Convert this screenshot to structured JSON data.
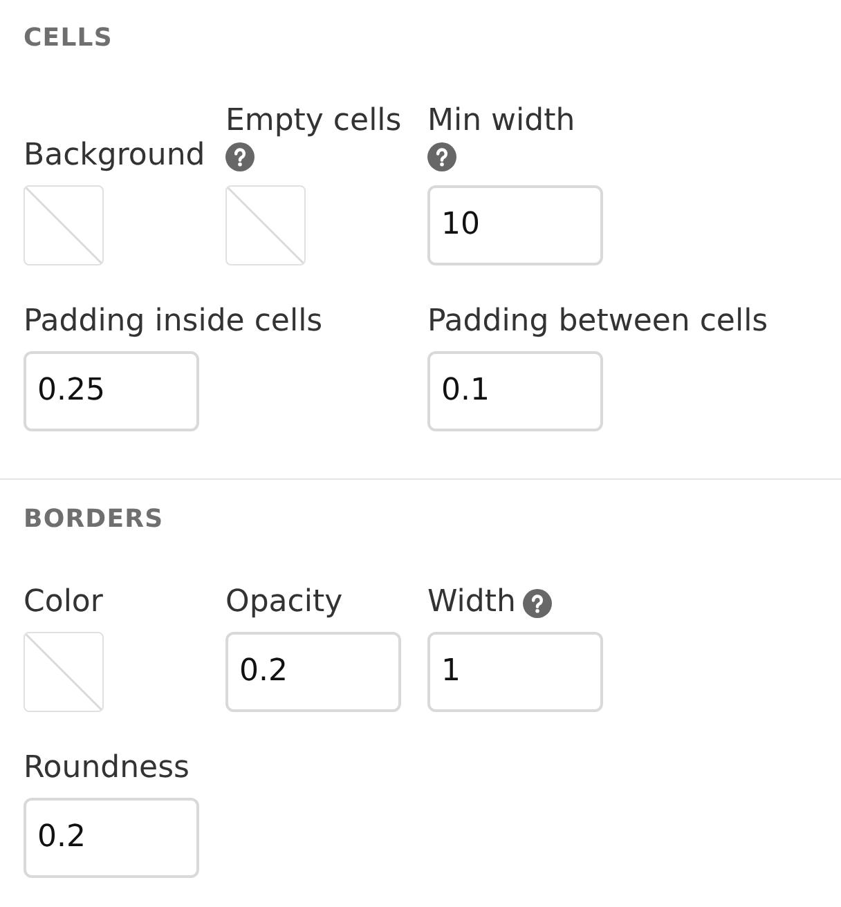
{
  "sections": [
    {
      "title": "CELLS",
      "rows": [
        [
          {
            "kind": "swatch",
            "label": "Background"
          },
          {
            "kind": "swatch",
            "label": "Empty cells",
            "help": true
          },
          {
            "kind": "number",
            "label": "Min width",
            "help": true,
            "value": "10"
          }
        ],
        [
          {
            "kind": "number",
            "label": "Padding inside cells",
            "value": "0.25"
          },
          "",
          {
            "kind": "number",
            "label": "Padding between cells",
            "value": "0.1"
          }
        ]
      ]
    },
    {
      "title": "BORDERS",
      "rows": [
        [
          {
            "kind": "swatch",
            "label": "Color"
          },
          {
            "kind": "number",
            "label": "Opacity",
            "value": "0.2"
          },
          {
            "kind": "number",
            "label": "Width",
            "help": true,
            "value": "1"
          }
        ],
        [
          {
            "kind": "number",
            "label": "Roundness",
            "value": "0.2"
          }
        ]
      ]
    }
  ]
}
